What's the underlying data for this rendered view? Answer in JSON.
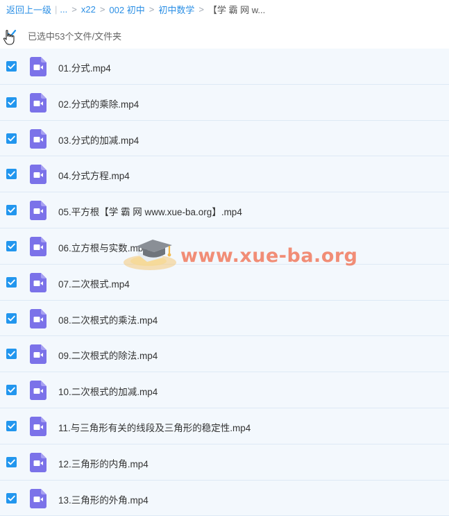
{
  "breadcrumb": {
    "back": "返回上一级",
    "bar": "|",
    "ellipsis": "...",
    "sep": ">",
    "items": [
      "x22",
      "002 初中",
      "初中数学"
    ],
    "current": "【学 霸 网 w..."
  },
  "selection": {
    "summary": "已选中53个文件/文件夹"
  },
  "icons": {
    "file_type": "video-file-icon",
    "checkbox": "checkmark-icon",
    "cursor": "hand-pointer-icon"
  },
  "colors": {
    "link": "#2b8fe5",
    "checkbox": "#2296ee",
    "row_bg": "#f3f8fd",
    "video_icon": "#7b72e9",
    "watermark": "#f06e50"
  },
  "files": [
    {
      "name": "01.分式.mp4",
      "checked": true
    },
    {
      "name": "02.分式的乘除.mp4",
      "checked": true
    },
    {
      "name": "03.分式的加减.mp4",
      "checked": true
    },
    {
      "name": "04.分式方程.mp4",
      "checked": true
    },
    {
      "name": "05.平方根【学 霸 网 www.xue-ba.org】.mp4",
      "checked": true
    },
    {
      "name": "06.立方根与实数.mp4",
      "checked": true
    },
    {
      "name": "07.二次根式.mp4",
      "checked": true
    },
    {
      "name": "08.二次根式的乘法.mp4",
      "checked": true
    },
    {
      "name": "09.二次根式的除法.mp4",
      "checked": true
    },
    {
      "name": "10.二次根式的加减.mp4",
      "checked": true
    },
    {
      "name": "11.与三角形有关的线段及三角形的稳定性.mp4",
      "checked": true
    },
    {
      "name": "12.三角形的内角.mp4",
      "checked": true
    },
    {
      "name": "13.三角形的外角.mp4",
      "checked": true
    }
  ],
  "watermark": {
    "text": "www.xue-ba.org"
  }
}
